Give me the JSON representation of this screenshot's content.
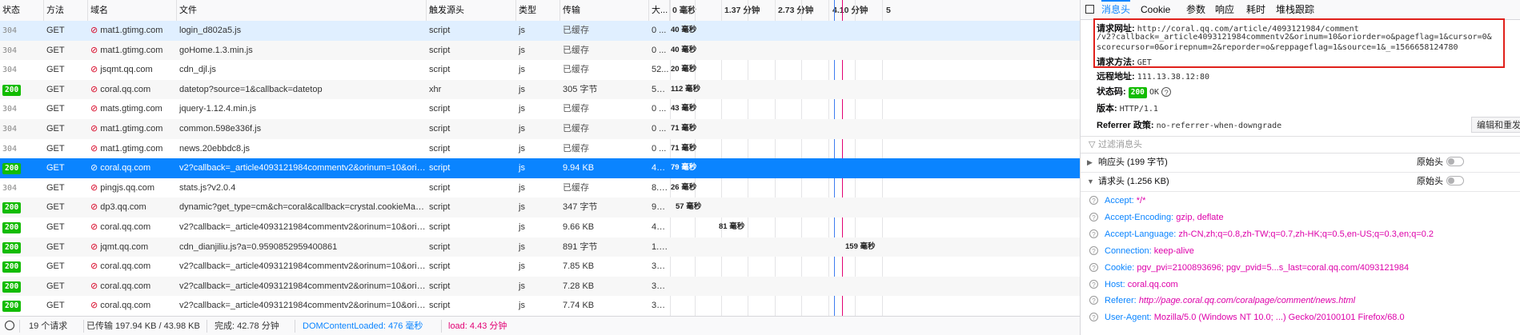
{
  "headers": {
    "status": "状态",
    "method": "方法",
    "domain": "域名",
    "file": "文件",
    "cause": "触发源头",
    "type": "类型",
    "transferred": "传输",
    "size": "大...",
    "timeline": [
      "0 毫秒",
      "1.37 分钟",
      "2.73 分钟",
      "4.10 分钟",
      "5"
    ]
  },
  "rows": [
    {
      "status": "304",
      "method": "GET",
      "domain": "mat1.gtimg.com",
      "file": "login_d802a5.js",
      "cause": "script",
      "type": "js",
      "transferred": "已缓存",
      "size": "0 ...",
      "timing": "40 毫秒",
      "hl": true
    },
    {
      "status": "304",
      "method": "GET",
      "domain": "mat1.gtimg.com",
      "file": "goHome.1.3.min.js",
      "cause": "script",
      "type": "js",
      "transferred": "已缓存",
      "size": "0 ...",
      "timing": "40 毫秒"
    },
    {
      "status": "304",
      "method": "GET",
      "domain": "jsqmt.qq.com",
      "file": "cdn_djl.js",
      "cause": "script",
      "type": "js",
      "transferred": "已缓存",
      "size": "52...",
      "timing": "20 毫秒"
    },
    {
      "status": "200",
      "method": "GET",
      "domain": "coral.qq.com",
      "file": "datetop?source=1&callback=datetop",
      "cause": "xhr",
      "type": "js",
      "transferred": "305 字节",
      "size": "59 ...",
      "timing": "112 毫秒"
    },
    {
      "status": "304",
      "method": "GET",
      "domain": "mats.gtimg.com",
      "file": "jquery-1.12.4.min.js",
      "cause": "script",
      "type": "js",
      "transferred": "已缓存",
      "size": "0 ...",
      "timing": "43 毫秒"
    },
    {
      "status": "304",
      "method": "GET",
      "domain": "mat1.gtimg.com",
      "file": "common.598e336f.js",
      "cause": "script",
      "type": "js",
      "transferred": "已缓存",
      "size": "0 ...",
      "timing": "71 毫秒"
    },
    {
      "status": "304",
      "method": "GET",
      "domain": "mat1.gtimg.com",
      "file": "news.20ebbdc8.js",
      "cause": "script",
      "type": "js",
      "transferred": "已缓存",
      "size": "0 ...",
      "timing": "71 毫秒"
    },
    {
      "status": "200",
      "method": "GET",
      "domain": "coral.qq.com",
      "file": "v2?callback=_article4093121984commentv2&orinum=10&oriorder=...",
      "cause": "script",
      "type": "js",
      "transferred": "9.94 KB",
      "size": "42....",
      "timing": "79 毫秒",
      "sel": true
    },
    {
      "status": "304",
      "method": "GET",
      "domain": "pingjs.qq.com",
      "file": "stats.js?v2.0.4",
      "cause": "script",
      "type": "js",
      "transferred": "已缓存",
      "size": "8.3...",
      "timing": "26 毫秒"
    },
    {
      "status": "200",
      "method": "GET",
      "domain": "dp3.qq.com",
      "file": "dynamic?get_type=cm&ch=coral&callback=crystal.cookieMapping",
      "cause": "script",
      "type": "js",
      "transferred": "347 字节",
      "size": "97 ...",
      "timing": "57 毫秒"
    },
    {
      "status": "200",
      "method": "GET",
      "domain": "coral.qq.com",
      "file": "v2?callback=_article4093121984commentv2&orinum=10&oriorder=...",
      "cause": "script",
      "type": "js",
      "transferred": "9.66 KB",
      "size": "43....",
      "timing": "81 毫秒"
    },
    {
      "status": "200",
      "method": "GET",
      "domain": "jqmt.qq.com",
      "file": "cdn_dianjiliu.js?a=0.9590852959400861",
      "cause": "script",
      "type": "js",
      "transferred": "891 字节",
      "size": "1.3...",
      "timing": "159 毫秒"
    },
    {
      "status": "200",
      "method": "GET",
      "domain": "coral.qq.com",
      "file": "v2?callback=_article4093121984commentv2&orinum=10&oriorder=...",
      "cause": "script",
      "type": "js",
      "transferred": "7.85 KB",
      "size": "34....",
      "timing": ""
    },
    {
      "status": "200",
      "method": "GET",
      "domain": "coral.qq.com",
      "file": "v2?callback=_article4093121984commentv2&orinum=10&oriorder=...",
      "cause": "script",
      "type": "js",
      "transferred": "7.28 KB",
      "size": "32....",
      "timing": ""
    },
    {
      "status": "200",
      "method": "GET",
      "domain": "coral.qq.com",
      "file": "v2?callback=_article4093121984commentv2&orinum=10&oriorder=...",
      "cause": "script",
      "type": "js",
      "transferred": "7.74 KB",
      "size": "34....",
      "timing": ""
    }
  ],
  "footer": {
    "requests": "19 个请求",
    "transferred": "已传输 197.94 KB / 43.98 KB",
    "finish": "完成: 42.78 分钟",
    "dcl": "DOMContentLoaded: 476 毫秒",
    "load": "load: 4.43 分钟"
  },
  "panel": {
    "tabs": [
      "消息头",
      "Cookie",
      "参数",
      "响应",
      "耗时",
      "堆栈跟踪"
    ],
    "url_label": "请求网址:",
    "url_line1": "http://coral.qq.com/article/4093121984/comment",
    "url_line2": "/v2?callback=_article4093121984commentv2&orinum=10&oriorder=o&pageflag=1&cursor=0&",
    "url_line3": "scorecursor=0&orirepnum=2&reporder=o&reppageflag=1&source=1&_=1566658124780",
    "method_label": "请求方法:",
    "method_value": "GET",
    "remote_label": "远程地址:",
    "remote_value": "111.13.38.12:80",
    "status_label": "状态码:",
    "status_code": "200",
    "status_text": "OK",
    "version_label": "版本:",
    "version_value": "HTTP/1.1",
    "referrer_label": "Referrer 政策:",
    "referrer_value": "no-referrer-when-downgrade",
    "edit_button": "编辑和重发",
    "filter_placeholder": "过滤消息头",
    "response_headers": "响应头 (199 字节)",
    "request_headers": "请求头 (1.256 KB)",
    "raw_label": "原始头",
    "request_header_list": [
      {
        "k": "Accept:",
        "v": "*/*"
      },
      {
        "k": "Accept-Encoding:",
        "v": "gzip, deflate"
      },
      {
        "k": "Accept-Language:",
        "v": "zh-CN,zh;q=0.8,zh-TW;q=0.7,zh-HK;q=0.5,en-US;q=0.3,en;q=0.2"
      },
      {
        "k": "Connection:",
        "v": "keep-alive"
      },
      {
        "k": "Cookie:",
        "v": "pgv_pvi=2100893696; pgv_pvid=5...s_last=coral.qq.com/4093121984"
      },
      {
        "k": "Host:",
        "v": "coral.qq.com"
      },
      {
        "k": "Referer:",
        "v": "http://page.coral.qq.com/coralpage/comment/news.html"
      },
      {
        "k": "User-Agent:",
        "v": "Mozilla/5.0 (Windows NT 10.0; ...) Gecko/20100101 Firefox/68.0"
      }
    ]
  },
  "colors": {
    "selected": "#0a84ff",
    "ok_badge": "#12bc00",
    "highlight_box": "#e0201a",
    "marker": "#e20074"
  }
}
